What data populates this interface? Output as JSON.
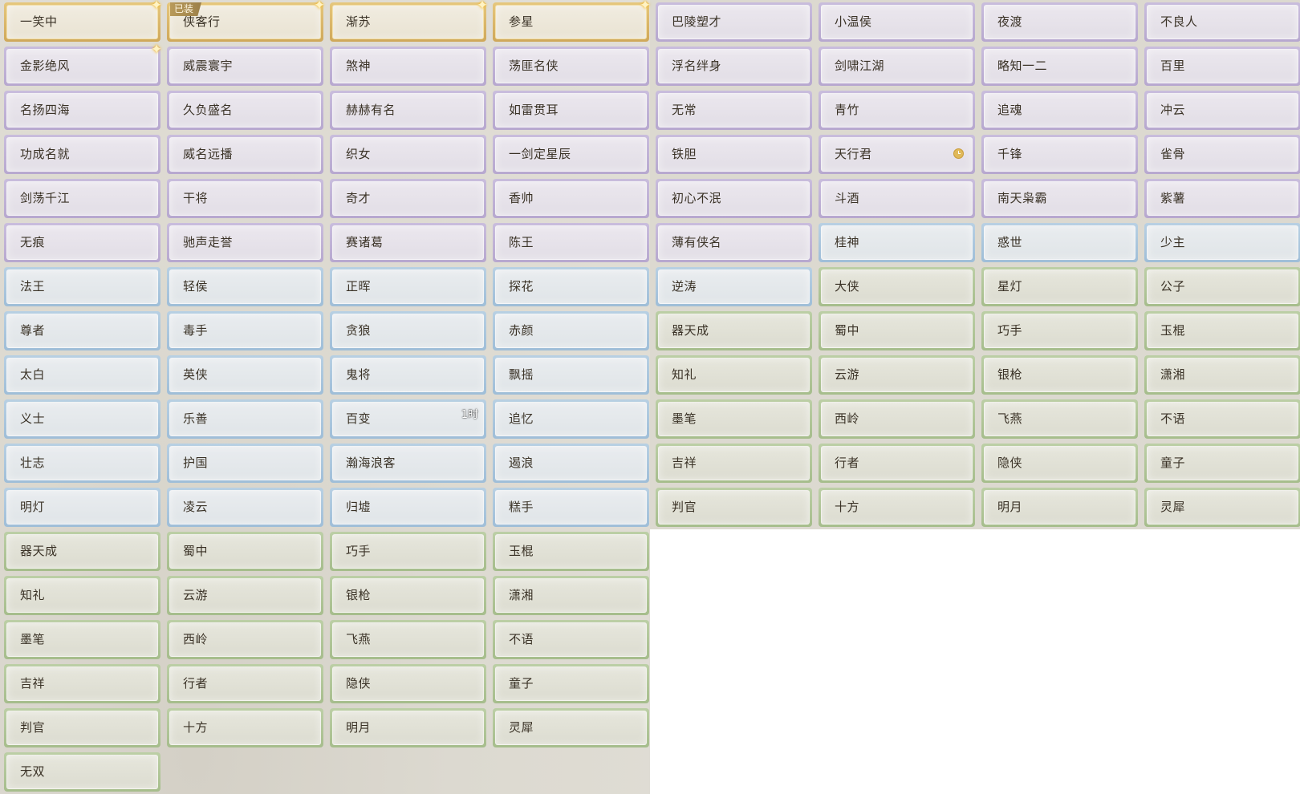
{
  "badges": {
    "equipped": "已装"
  },
  "colors": {
    "gold": "#cfa85a",
    "purple": "#b7a8cf",
    "blue": "#9fbed8",
    "green": "#a6bd8c"
  },
  "titles_right": [
    [
      {
        "label": "一笑中",
        "rarity": "gold",
        "sparkle": true
      },
      {
        "label": "侠客行",
        "rarity": "gold",
        "sparkle": true,
        "equipped": true
      },
      {
        "label": "渐苏",
        "rarity": "gold",
        "sparkle": true
      },
      {
        "label": "参星",
        "rarity": "gold",
        "sparkle": true
      },
      {
        "label": "巴陵塑才",
        "rarity": "purple"
      },
      {
        "label": "小温侯",
        "rarity": "purple"
      },
      {
        "label": "夜渡",
        "rarity": "purple"
      },
      {
        "label": "不良人",
        "rarity": "purple"
      }
    ],
    [
      {
        "label": "金影绝风",
        "rarity": "purple",
        "sparkle": true
      },
      {
        "label": "威震寰宇",
        "rarity": "purple"
      },
      {
        "label": "煞神",
        "rarity": "purple"
      },
      {
        "label": "荡匪名侠",
        "rarity": "purple"
      },
      {
        "label": "浮名绊身",
        "rarity": "purple"
      },
      {
        "label": "剑啸江湖",
        "rarity": "purple"
      },
      {
        "label": "略知一二",
        "rarity": "purple"
      },
      {
        "label": "百里",
        "rarity": "purple"
      }
    ],
    [
      {
        "label": "名扬四海",
        "rarity": "purple"
      },
      {
        "label": "久负盛名",
        "rarity": "purple"
      },
      {
        "label": "赫赫有名",
        "rarity": "purple"
      },
      {
        "label": "如雷贯耳",
        "rarity": "purple"
      },
      {
        "label": "无常",
        "rarity": "purple"
      },
      {
        "label": "青竹",
        "rarity": "purple"
      },
      {
        "label": "追魂",
        "rarity": "purple"
      },
      {
        "label": "冲云",
        "rarity": "purple"
      }
    ],
    [
      {
        "label": "功成名就",
        "rarity": "purple"
      },
      {
        "label": "威名远播",
        "rarity": "purple"
      },
      {
        "label": "织女",
        "rarity": "purple"
      },
      {
        "label": "一剑定星辰",
        "rarity": "purple"
      },
      {
        "label": "铁胆",
        "rarity": "purple"
      },
      {
        "label": "天行君",
        "rarity": "purple",
        "clock": true
      },
      {
        "label": "千锋",
        "rarity": "purple"
      },
      {
        "label": "雀骨",
        "rarity": "purple"
      }
    ],
    [
      {
        "label": "剑荡千江",
        "rarity": "purple"
      },
      {
        "label": "干将",
        "rarity": "purple"
      },
      {
        "label": "奇才",
        "rarity": "purple"
      },
      {
        "label": "香帅",
        "rarity": "purple"
      },
      {
        "label": "初心不泯",
        "rarity": "purple"
      },
      {
        "label": "斗酒",
        "rarity": "purple"
      },
      {
        "label": "南天枭霸",
        "rarity": "purple"
      },
      {
        "label": "紫薯",
        "rarity": "purple"
      }
    ],
    [
      {
        "label": "无痕",
        "rarity": "purple"
      },
      {
        "label": "驰声走誉",
        "rarity": "purple"
      },
      {
        "label": "赛诸葛",
        "rarity": "purple"
      },
      {
        "label": "陈王",
        "rarity": "purple"
      },
      {
        "label": "薄有侠名",
        "rarity": "purple"
      },
      {
        "label": "桂神",
        "rarity": "blue"
      },
      {
        "label": "惑世",
        "rarity": "blue"
      },
      {
        "label": "少主",
        "rarity": "blue"
      }
    ],
    [
      {
        "label": "法王",
        "rarity": "blue"
      },
      {
        "label": "轻侯",
        "rarity": "blue"
      },
      {
        "label": "正晖",
        "rarity": "blue"
      },
      {
        "label": "探花",
        "rarity": "blue"
      },
      {
        "label": "逆涛",
        "rarity": "blue"
      },
      {
        "label": "大侠",
        "rarity": "green"
      },
      {
        "label": "星灯",
        "rarity": "green"
      },
      {
        "label": "公子",
        "rarity": "green"
      }
    ],
    [
      {
        "label": "尊者",
        "rarity": "blue"
      },
      {
        "label": "毒手",
        "rarity": "blue"
      },
      {
        "label": "贪狼",
        "rarity": "blue"
      },
      {
        "label": "赤颜",
        "rarity": "blue"
      },
      {
        "label": "器天成",
        "rarity": "green"
      },
      {
        "label": "蜀中",
        "rarity": "green"
      },
      {
        "label": "巧手",
        "rarity": "green"
      },
      {
        "label": "玉棍",
        "rarity": "green"
      }
    ],
    [
      {
        "label": "太白",
        "rarity": "blue"
      },
      {
        "label": "英侠",
        "rarity": "blue"
      },
      {
        "label": "鬼将",
        "rarity": "blue"
      },
      {
        "label": "飘摇",
        "rarity": "blue"
      },
      {
        "label": "知礼",
        "rarity": "green"
      },
      {
        "label": "云游",
        "rarity": "green"
      },
      {
        "label": "银枪",
        "rarity": "green"
      },
      {
        "label": "潇湘",
        "rarity": "green"
      }
    ],
    [
      {
        "label": "义士",
        "rarity": "blue"
      },
      {
        "label": "乐善",
        "rarity": "blue"
      },
      {
        "label": "百变",
        "rarity": "blue",
        "timer": "1时"
      },
      {
        "label": "追忆",
        "rarity": "blue"
      },
      {
        "label": "墨笔",
        "rarity": "green"
      },
      {
        "label": "西岭",
        "rarity": "green"
      },
      {
        "label": "飞燕",
        "rarity": "green"
      },
      {
        "label": "不语",
        "rarity": "green"
      }
    ],
    [
      {
        "label": "壮志",
        "rarity": "blue"
      },
      {
        "label": "护国",
        "rarity": "blue"
      },
      {
        "label": "瀚海浪客",
        "rarity": "blue"
      },
      {
        "label": "遏浪",
        "rarity": "blue"
      },
      {
        "label": "吉祥",
        "rarity": "green"
      },
      {
        "label": "行者",
        "rarity": "green"
      },
      {
        "label": "隐侠",
        "rarity": "green"
      },
      {
        "label": "童子",
        "rarity": "green"
      }
    ],
    [
      {
        "label": "明灯",
        "rarity": "blue"
      },
      {
        "label": "凌云",
        "rarity": "blue"
      },
      {
        "label": "归墟",
        "rarity": "blue"
      },
      {
        "label": "糕手",
        "rarity": "blue"
      },
      {
        "label": "判官",
        "rarity": "green"
      },
      {
        "label": "十方",
        "rarity": "green"
      },
      {
        "label": "明月",
        "rarity": "green"
      },
      {
        "label": "灵犀",
        "rarity": "green"
      }
    ],
    [
      {
        "label": "器天成",
        "rarity": "green"
      },
      {
        "label": "蜀中",
        "rarity": "green"
      },
      {
        "label": "巧手",
        "rarity": "green"
      },
      {
        "label": "玉棍",
        "rarity": "green"
      }
    ],
    [
      {
        "label": "知礼",
        "rarity": "green"
      },
      {
        "label": "云游",
        "rarity": "green"
      },
      {
        "label": "银枪",
        "rarity": "green"
      },
      {
        "label": "潇湘",
        "rarity": "green"
      }
    ],
    [
      {
        "label": "墨笔",
        "rarity": "green"
      },
      {
        "label": "西岭",
        "rarity": "green"
      },
      {
        "label": "飞燕",
        "rarity": "green"
      },
      {
        "label": "不语",
        "rarity": "green"
      }
    ],
    [
      {
        "label": "吉祥",
        "rarity": "green"
      },
      {
        "label": "行者",
        "rarity": "green"
      },
      {
        "label": "隐侠",
        "rarity": "green"
      },
      {
        "label": "童子",
        "rarity": "green"
      }
    ],
    [
      {
        "label": "判官",
        "rarity": "green"
      },
      {
        "label": "十方",
        "rarity": "green"
      },
      {
        "label": "明月",
        "rarity": "green"
      },
      {
        "label": "灵犀",
        "rarity": "green"
      }
    ],
    [
      {
        "label": "无双",
        "rarity": "green"
      }
    ]
  ]
}
